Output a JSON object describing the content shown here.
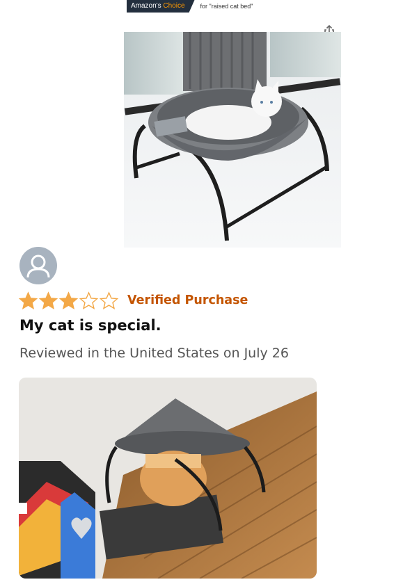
{
  "badge": {
    "label_prefix": "Amazon's ",
    "label_accent": "Choice",
    "for_text": "for \"raised cat bed\""
  },
  "icons": {
    "share": "share-icon",
    "avatar": "user-avatar-icon",
    "star_full": "star-filled-icon",
    "star_empty": "star-empty-icon"
  },
  "colors": {
    "badge_bg": "#232f3e",
    "badge_accent": "#ff9900",
    "star_fill": "#f3a847",
    "verified": "#c45500",
    "avatar_bg": "#a8b3bf"
  },
  "product": {
    "image_alt": "Grey raised cat bed with white cat near window"
  },
  "review": {
    "rating": 3,
    "rating_max": 5,
    "verified_label": "Verified Purchase",
    "title": "My cat is special.",
    "date_line": "Reviewed in the United States on July 26",
    "image_alt": "Orange cat standing underneath raised cat bed on wooden floor"
  }
}
